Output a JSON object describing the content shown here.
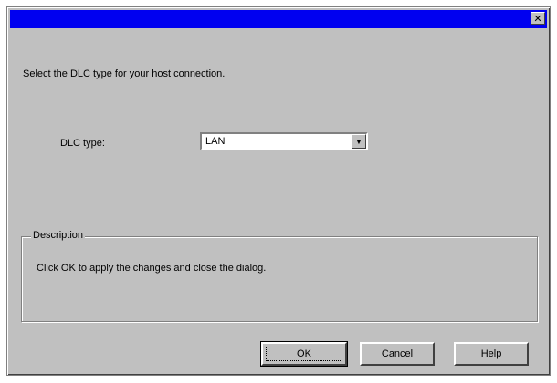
{
  "window": {
    "title": "",
    "close_glyph": "✕"
  },
  "intro_text": "Select the DLC type for your host connection.",
  "dlc": {
    "label": "DLC type:",
    "selected": "LAN",
    "arrow_glyph": "▼"
  },
  "description": {
    "legend": "Description",
    "text": "Click OK to apply the changes and close the dialog."
  },
  "buttons": {
    "ok": "OK",
    "cancel": "Cancel",
    "help": "Help"
  },
  "colors": {
    "titlebar": "#0000f0",
    "face": "#c0c0c0"
  }
}
